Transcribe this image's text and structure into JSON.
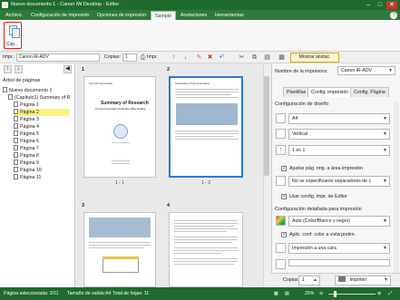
{
  "window": {
    "title": "Nuevo documento 1 - Canon iW Desktop - Editor"
  },
  "menu": {
    "tabs": [
      {
        "label": "Archivo"
      },
      {
        "label": "Configuración de impresión"
      },
      {
        "label": "Opciones de impresión"
      },
      {
        "label": "Sample"
      },
      {
        "label": "Anotaciones"
      },
      {
        "label": "Herramientas"
      }
    ],
    "active": "Sample"
  },
  "ribbon": {
    "copy_label": "Cop..."
  },
  "toolbar": {
    "printer_label": "Impr.:",
    "printer_value": "Canon iR-ADV",
    "copies_label": "Copias:",
    "copies_value": "1",
    "impr_btn": "Impr.",
    "show_annotations": "Mostrar anotac."
  },
  "left_panel": {
    "tree_title": "Árbol de páginas",
    "root": "Nuevo documento 1",
    "chapter": "(Capítulo1) Summary of R",
    "pages": [
      "Página 1",
      "Página 2",
      "Página 3",
      "Página 4",
      "Página 5",
      "Página 6",
      "Página 7",
      "Página 8",
      "Página 9",
      "Página 10",
      "Página 11"
    ],
    "selected_index": 1
  },
  "preview": {
    "thumbs": [
      {
        "num": "1",
        "label": "1 - 1",
        "title": "For GS Corporation",
        "heading": "Summary of Research",
        "sub": "The Next Generation of Mid-Rise Office Building"
      },
      {
        "num": "2",
        "label": "1 - 2",
        "title": "Introduction of GS Corporation"
      },
      {
        "num": "3",
        "label": ""
      },
      {
        "num": "4",
        "label": ""
      }
    ]
  },
  "right_panel": {
    "printer_name_label": "Nombre de la impresora:",
    "printer_name_value": "Canon iR-ADV",
    "tabs": [
      "Plantillas",
      "Config. impresión",
      "Config. Página"
    ],
    "active_tab": "Config. impresión",
    "layout_section": "Configuración de diseño",
    "paper_size": "A4",
    "orientation": "Vertical",
    "pages_per_sheet": "1 en 1",
    "fit_area": "Ajustar pág. orig. a área impresión",
    "separator": "No se especificaron separadores de c",
    "use_editor_config": "Usar config. impr. de Editor",
    "detail_section": "Configuración detallada para impresión",
    "color_mode": "Auto (Color/Blanco y negro)",
    "apply_color": "Aplic. conf. color a vista prelim.",
    "sides": "Impresión a una cara",
    "copies_label": "Copias",
    "copies_value": "1",
    "print_button": "Imprimir"
  },
  "status": {
    "selected_page": "Página seleccionada: 2/11",
    "output_size": "Tamaño de salida:A4",
    "total_sheets": "Total de hojas: 11",
    "zoom": "25%"
  }
}
